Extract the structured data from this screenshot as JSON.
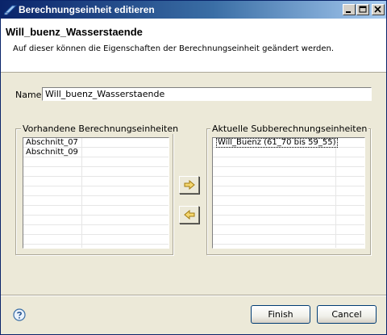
{
  "window": {
    "title": "Berechnungseinheit editieren"
  },
  "banner": {
    "heading": "Will_buenz_Wasserstaende",
    "description": "Auf dieser können die Eigenschaften der Berechnungseinheit geändert werden."
  },
  "form": {
    "name_label": "Name",
    "name_value": "Will_buenz_Wasserstaende"
  },
  "available": {
    "title": "Vorhandene Berechnungseinheiten",
    "items": [
      "Abschnitt_07",
      "Abschnitt_09"
    ]
  },
  "current": {
    "title": "Aktuelle Subberechnungseinheiten",
    "items": [
      "Will_Buenz (61_70 bis 59_55)"
    ]
  },
  "buttons": {
    "finish": "Finish",
    "cancel": "Cancel"
  },
  "icons": {
    "app": "app-icon",
    "help": "help-icon",
    "add": "arrow-right-icon",
    "remove": "arrow-left-icon"
  },
  "colors": {
    "titlebar_start": "#0a246a",
    "arrow_fill": "#f5d76e",
    "help_blue": "#3a6ea5"
  }
}
